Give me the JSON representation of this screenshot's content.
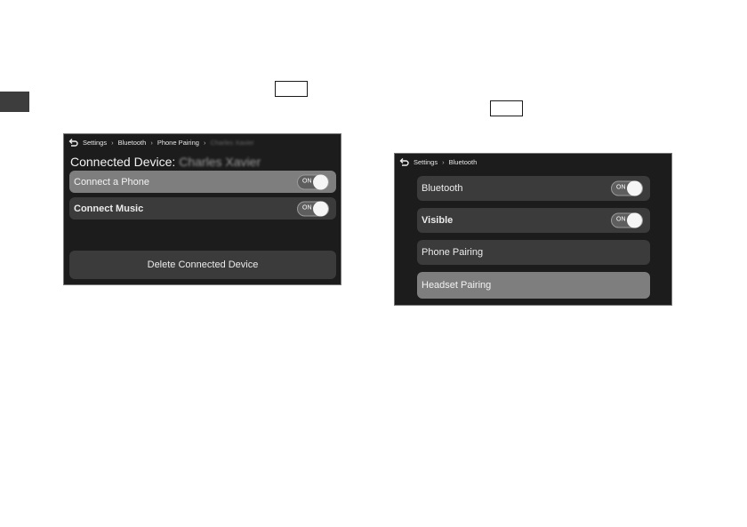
{
  "left_screen": {
    "breadcrumb": [
      "Settings",
      "Bluetooth",
      "Phone Pairing",
      "Charles Xavier"
    ],
    "title_prefix": "Connected Device:",
    "title_device": "Charles Xavier",
    "rows": [
      {
        "label": "Connect a Phone",
        "toggle": "ON"
      },
      {
        "label": "Connect Music",
        "toggle": "ON"
      }
    ],
    "delete_label": "Delete Connected Device"
  },
  "right_screen": {
    "breadcrumb": [
      "Settings",
      "Bluetooth"
    ],
    "rows": [
      {
        "label": "Bluetooth",
        "toggle": "ON"
      },
      {
        "label": "Visible",
        "toggle": "ON"
      },
      {
        "label": "Phone Pairing"
      },
      {
        "label": "Headset Pairing"
      }
    ]
  },
  "icons": {
    "back": "back-arrow-icon",
    "separator": "chevron-right-icon"
  },
  "colors": {
    "screen_bg": "#1c1c1c",
    "row_dark": "#3b3b3b",
    "row_highlight": "#7e7e7e",
    "side_tab": "#3d3d3d"
  }
}
